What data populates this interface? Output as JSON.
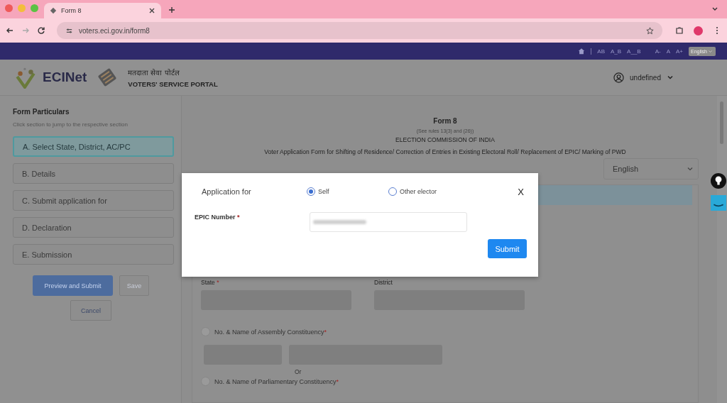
{
  "browser": {
    "tab_title": "Form 8",
    "url": "voters.eci.gov.in/form8"
  },
  "topbar": {
    "items": [
      "AB",
      "A_B",
      "A__B",
      "A-",
      "A",
      "A+"
    ],
    "language": "English"
  },
  "header": {
    "brand": "ECINet",
    "portal_hindi": "मतदाता सेवा पोर्टल",
    "portal": "VOTERS' SERVICE PORTAL",
    "user": "undefined"
  },
  "sidebar": {
    "title": "Form Particulars",
    "hint": "Click section to jump to the respective section",
    "sections": [
      {
        "label": "A. Select State, District, AC/PC",
        "selected": true
      },
      {
        "label": "B. Details",
        "selected": false
      },
      {
        "label": "C. Submit application for",
        "selected": false
      },
      {
        "label": "D. Declaration",
        "selected": false
      },
      {
        "label": "E. Submission",
        "selected": false
      }
    ],
    "preview": "Preview and Submit",
    "save": "Save",
    "cancel": "Cancel"
  },
  "form": {
    "title": "Form 8",
    "rules": "(See rules 13(3) and (26))",
    "authority": "ELECTION COMMISSION OF INDIA",
    "subtitle": "Voter Application Form for Shifting of Residence/ Correction of Entries in Existing Electoral Roll/ Replacement of EPIC/ Marking of PWD",
    "language": "English",
    "state": {
      "label": "State",
      "required_mark": "*"
    },
    "district": {
      "label": "District"
    },
    "assembly": {
      "label": "No. & Name of Assembly Constituency",
      "required_mark": "*",
      "selected": false
    },
    "or": "Or",
    "parliamentary": {
      "label": "No. & Name of Parliamentary Constituency",
      "required_mark": "*",
      "selected": false
    }
  },
  "dialog": {
    "label": "Application for",
    "options": [
      {
        "label": "Self",
        "selected": true
      },
      {
        "label": "Other elector",
        "selected": false
      }
    ],
    "close": "X",
    "epic": {
      "label": "EPIC Number",
      "required_mark": "*"
    },
    "submit": "Submit"
  }
}
